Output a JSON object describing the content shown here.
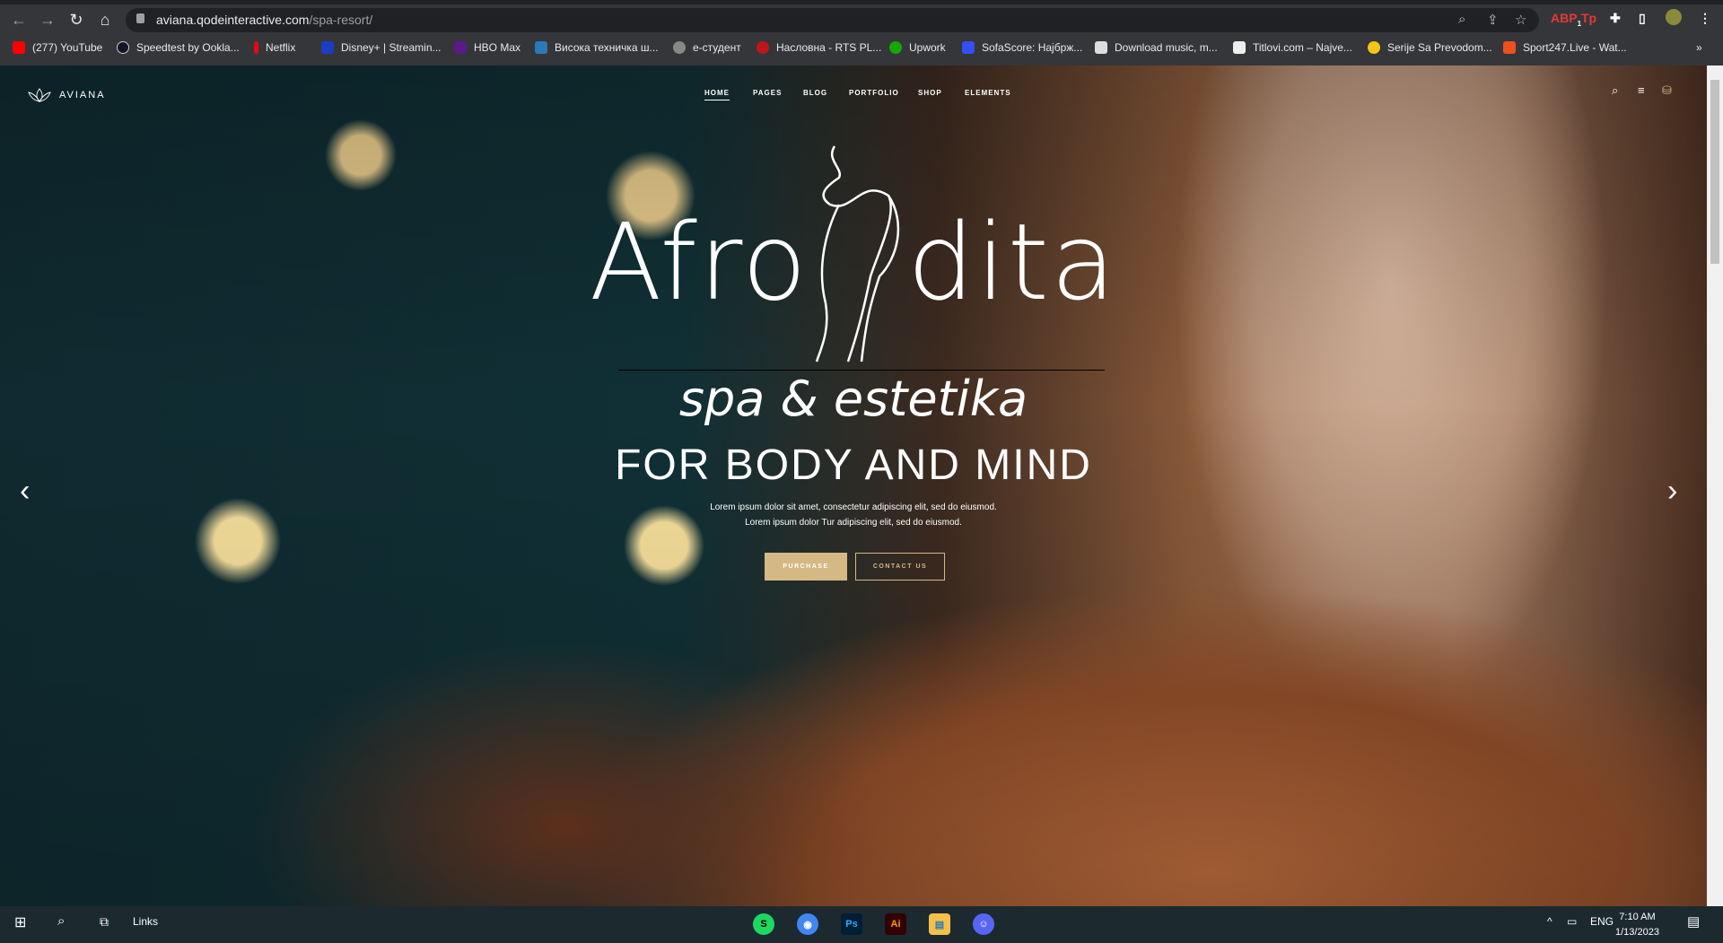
{
  "browser": {
    "url_host": "aviana.qodeinteractive.com",
    "url_path": "/spa-resort/",
    "ext_badge": "1",
    "bookmarks": [
      {
        "label": "(277) YouTube",
        "color": "#ff0000"
      },
      {
        "label": "Speedtest by Ookla...",
        "color": "#141526"
      },
      {
        "label": "Netflix",
        "color": "#e50914"
      },
      {
        "label": "Disney+ | Streamin...",
        "color": "#1b3cc4"
      },
      {
        "label": "HBO Max",
        "color": "#5a1a8a"
      },
      {
        "label": "Висока техничка ш...",
        "color": "#2a7ab8"
      },
      {
        "label": "e-студент",
        "color": "#888888"
      },
      {
        "label": "Насловна - RTS PL...",
        "color": "#c0161b"
      },
      {
        "label": "Upwork",
        "color": "#14a800"
      },
      {
        "label": "SofaScore: Најбрж...",
        "color": "#374df5"
      },
      {
        "label": "Download music, m...",
        "color": "#dddddd"
      },
      {
        "label": "Titlovi.com – Najve...",
        "color": "#222222"
      },
      {
        "label": "Serije Sa Prevodom...",
        "color": "#f5c518"
      },
      {
        "label": "Sport247.Live - Wat...",
        "color": "#f0501e"
      }
    ],
    "more": "»"
  },
  "site": {
    "logo": "AVIANA",
    "nav": [
      "HOME",
      "PAGES",
      "BLOG",
      "PORTFOLIO",
      "SHOP",
      "ELEMENTS"
    ],
    "hero": {
      "title_left": "Afro",
      "title_right": "dita",
      "subtitle": "spa & estetika",
      "tagline": "FOR BODY AND MIND",
      "text_1": "Lorem ipsum dolor sit amet, consectetur adipiscing elit, sed do eiusmod.",
      "text_2": "Lorem ipsum dolor Tur adipiscing elit, sed do eiusmod.",
      "purchase": "PURCHASE",
      "contact": "CONTACT US",
      "prev": "‹",
      "next": "›"
    },
    "accent": "#d5b985"
  },
  "taskbar": {
    "links": "Links",
    "lang": "ENG",
    "time": "7:10 AM",
    "date": "1/13/2023",
    "apps": [
      {
        "label": "S",
        "color": "#1ed760"
      },
      {
        "label": "◉",
        "color": "#4285f4"
      },
      {
        "label": "Ps",
        "color": "#001e36"
      },
      {
        "label": "Ai",
        "color": "#330000"
      },
      {
        "label": "▤",
        "color": "#f3c04a"
      },
      {
        "label": "☺",
        "color": "#5865f2"
      }
    ]
  }
}
